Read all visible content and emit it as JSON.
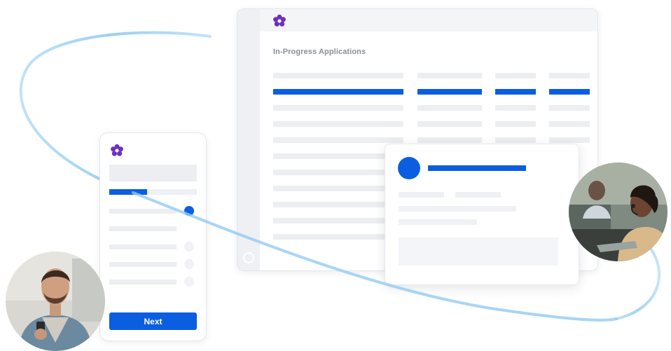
{
  "desktop": {
    "title": "In-Progress Applications"
  },
  "mobile": {
    "next_label": "Next",
    "progress_fraction": 0.43,
    "active_step": 1
  },
  "photos": {
    "left": "man-using-phone-photo",
    "right": "agent-with-headset-photo"
  },
  "colors": {
    "accent": "#0b5ee0",
    "logo": "#6f2fbf",
    "orbit": "#9ccdf0",
    "placeholder": "#eceef1"
  },
  "icons": {
    "logo": "flower-logo-icon",
    "step": "step-dot-icon"
  }
}
